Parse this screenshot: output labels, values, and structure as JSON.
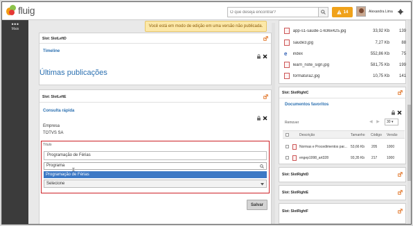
{
  "header": {
    "logo_text": "fluig",
    "search_placeholder": "O que deseja encontrar?",
    "notification_count": "14",
    "user_name": "Alexandra Lima"
  },
  "sidebar": {
    "more_label": "Mais"
  },
  "banner": {
    "text": "Você está em modo de edição em uma versão não publicada."
  },
  "left": {
    "slot1_title": "Slot: SlotLeftD",
    "timeline_title": "Timeline",
    "latest_posts": "Últimas publicações",
    "slot2_title": "Slot: SlotLeftE",
    "quick_title": "Consulta rápida",
    "empresa_label": "Empresa",
    "empresa_value": "TOTVS SA",
    "titulo_label": "Título",
    "field_value": "Programação de Férias",
    "dd_search_value": "Programa",
    "dd_option": "Programação de Férias",
    "dd_select": "Selecione",
    "save_button": "Salvar"
  },
  "right": {
    "files": [
      {
        "name": "app-s1-saude-1-636x425.jpg",
        "size": "33,92 Kb",
        "count": "139",
        "icon": "image-file-icon"
      },
      {
        "name": "saude3.jpg",
        "size": "7,27 Kb",
        "count": "88",
        "icon": "image-file-icon"
      },
      {
        "name": "index",
        "size": "552,86 Kb",
        "count": "75",
        "icon": "ie-icon"
      },
      {
        "name": "learn_note_sign.jpg",
        "size": "581,75 Kb",
        "count": "199",
        "icon": "image-file-icon"
      },
      {
        "name": "formatura2.jpg",
        "size": "10,75 Kb",
        "count": "141",
        "icon": "image-file-icon"
      }
    ],
    "slotC_title": "Slot: SlotRightC",
    "docs_title": "Documentos favoritos",
    "remove_label": "Remover",
    "page_size": "30",
    "columns": [
      "Descrição",
      "Tamanho",
      "Código",
      "Versão"
    ],
    "docs": [
      {
        "desc": "Normas e Procedimentos par...",
        "size": "53,66 Kb",
        "code": "205",
        "version": "1000"
      },
      {
        "desc": "engep1998_art328",
        "size": "93,35 Kb",
        "code": "217",
        "version": "1000"
      }
    ],
    "slotD_title": "Slot: SlotRightD",
    "slotE_title": "Slot: SlotRightE",
    "slotF_title": "Slot: SlotRightF"
  },
  "colors": {
    "accent": "#2a6fb0",
    "highlight": "#cc1f24",
    "notification": "#f0a21a",
    "selected": "#3d79c5"
  }
}
